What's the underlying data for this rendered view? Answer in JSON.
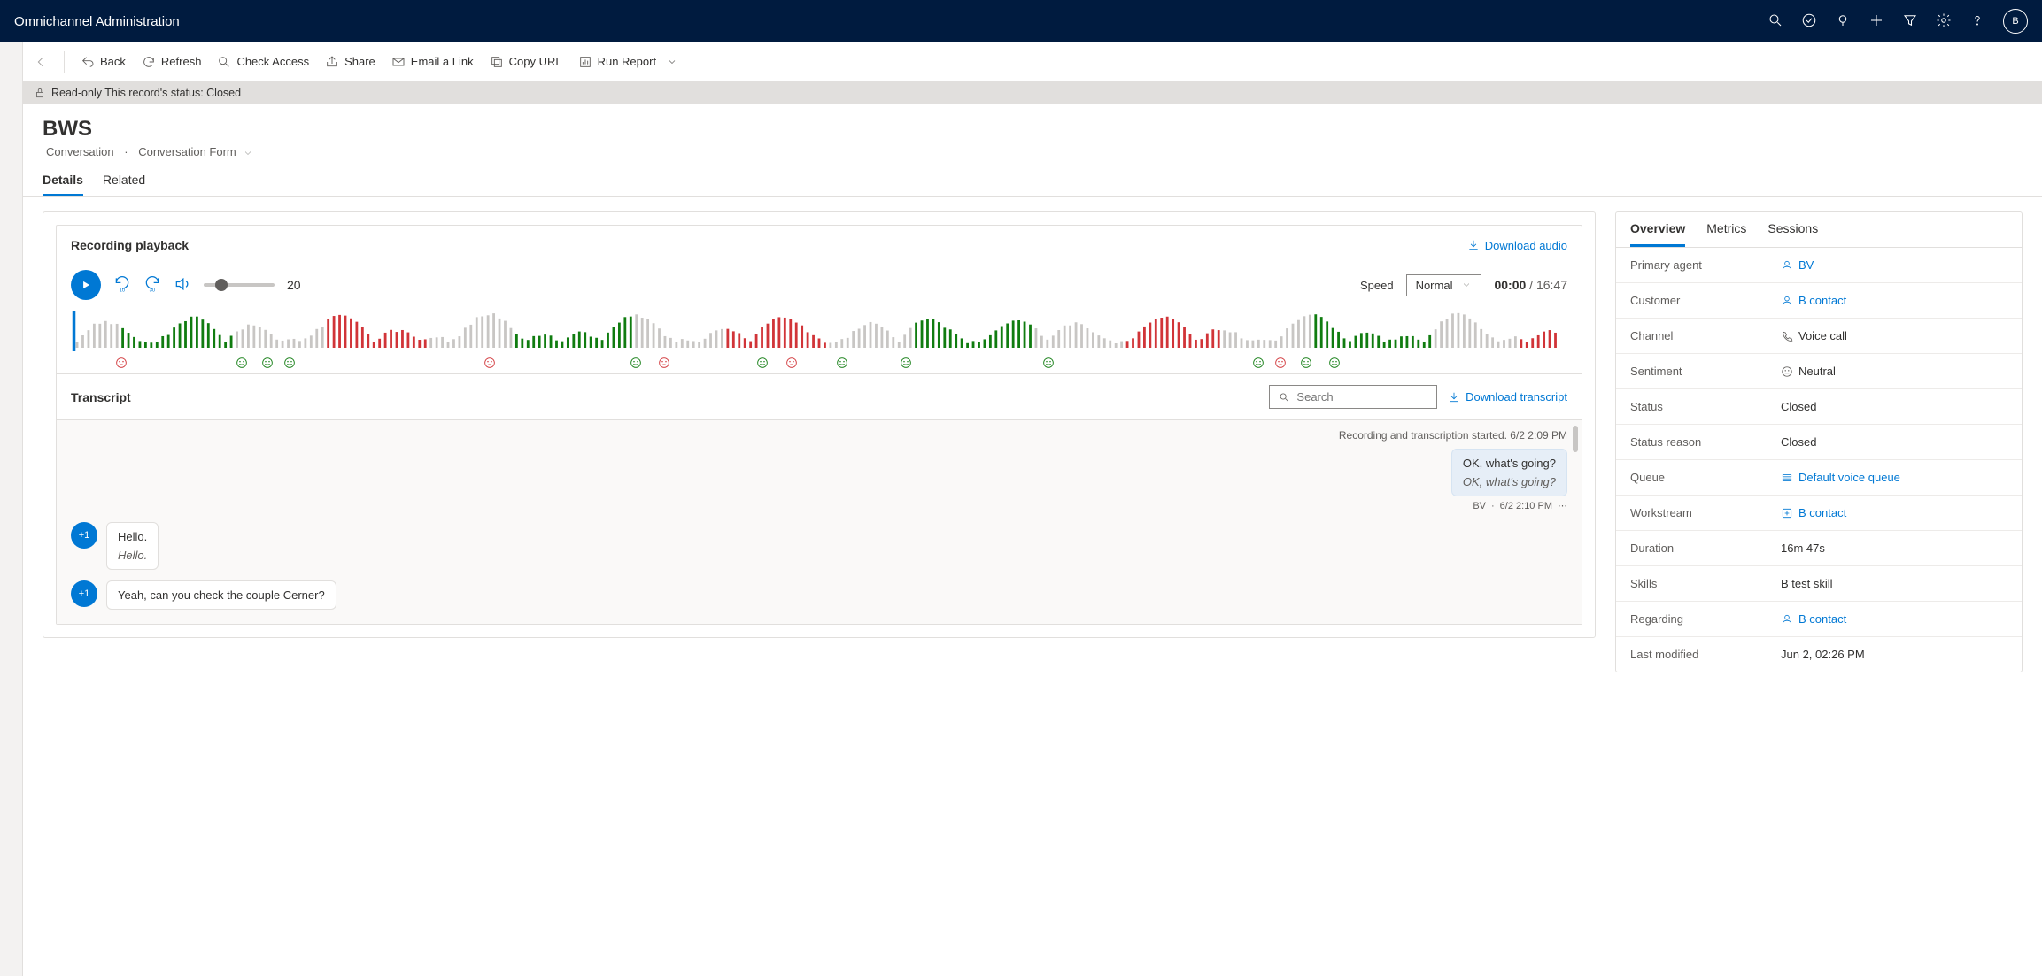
{
  "app": {
    "title": "Omnichannel Administration",
    "avatar": "B"
  },
  "commands": {
    "back": "Back",
    "refresh": "Refresh",
    "check_access": "Check Access",
    "share": "Share",
    "email_link": "Email a Link",
    "copy_url": "Copy URL",
    "run_report": "Run Report"
  },
  "readonly_banner": "Read-only This record's status: Closed",
  "header": {
    "title": "BWS",
    "crumb1": "Conversation",
    "crumb2": "Conversation Form"
  },
  "tabs": {
    "details": "Details",
    "related": "Related"
  },
  "recording": {
    "title": "Recording playback",
    "download": "Download audio",
    "volume": "20",
    "speed_label": "Speed",
    "speed_value": "Normal",
    "elapsed": "00:00",
    "total": "16:47"
  },
  "transcript": {
    "title": "Transcript",
    "search_placeholder": "Search",
    "download": "Download transcript",
    "system_line": "Recording and transcription started. 6/2 2:09 PM",
    "agent_msg": "OK, what's going?",
    "agent_msg_italic": "OK, what's going?",
    "agent_name": "BV",
    "agent_time": "6/2 2:10 PM",
    "cust_badge": "+1",
    "cust_msg1": "Hello.",
    "cust_msg1_italic": "Hello.",
    "cust_msg2": "Yeah, can you check the couple Cerner?"
  },
  "overview": {
    "tabs": {
      "overview": "Overview",
      "metrics": "Metrics",
      "sessions": "Sessions"
    },
    "rows": {
      "primary_agent": {
        "label": "Primary agent",
        "value": "BV"
      },
      "customer": {
        "label": "Customer",
        "value": "B contact"
      },
      "channel": {
        "label": "Channel",
        "value": "Voice call"
      },
      "sentiment": {
        "label": "Sentiment",
        "value": "Neutral"
      },
      "status": {
        "label": "Status",
        "value": "Closed"
      },
      "status_reason": {
        "label": "Status reason",
        "value": "Closed"
      },
      "queue": {
        "label": "Queue",
        "value": "Default voice queue"
      },
      "workstream": {
        "label": "Workstream",
        "value": "B contact"
      },
      "duration": {
        "label": "Duration",
        "value": "16m 47s"
      },
      "skills": {
        "label": "Skills",
        "value": "B test skill"
      },
      "regarding": {
        "label": "Regarding",
        "value": "B contact"
      },
      "last_modified": {
        "label": "Last modified",
        "value": "Jun 2, 02:26 PM"
      }
    }
  }
}
